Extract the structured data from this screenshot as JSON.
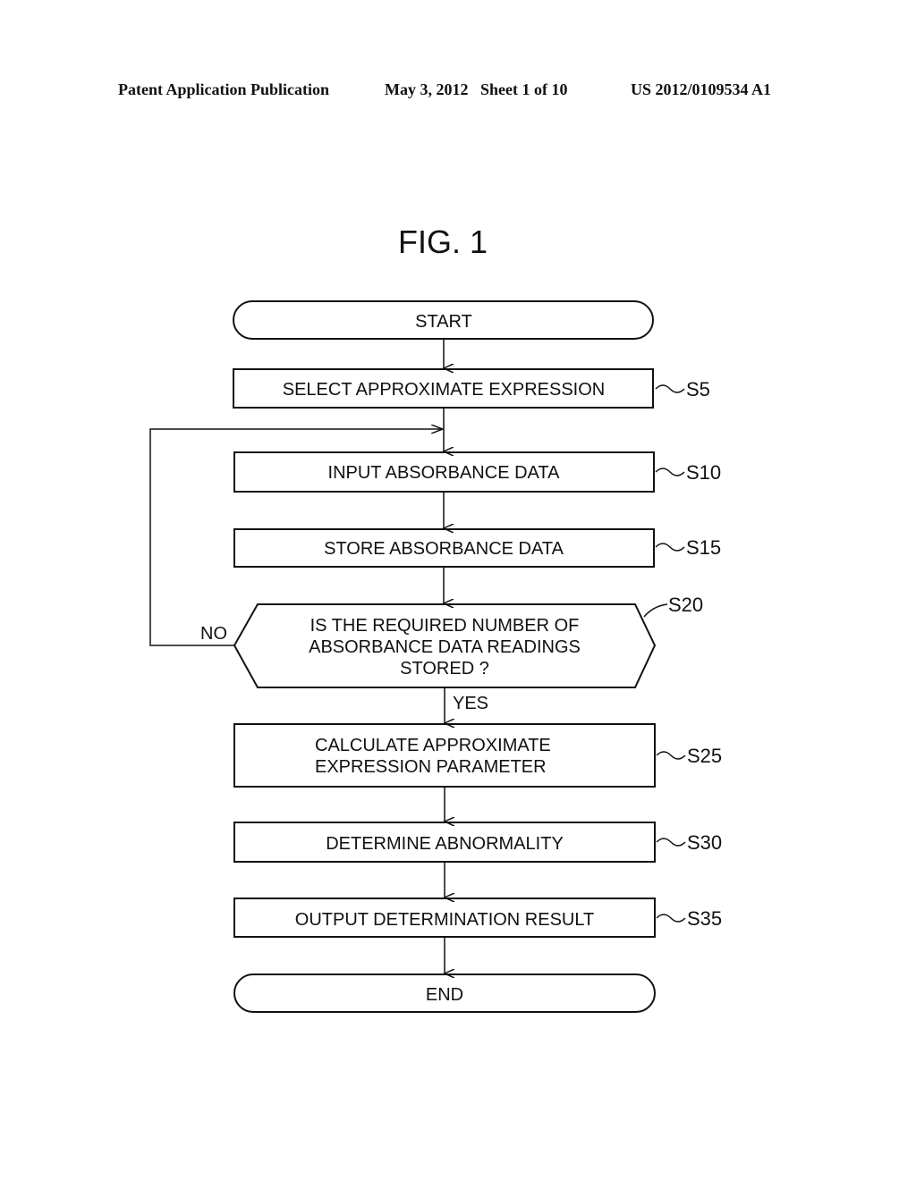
{
  "header": {
    "publication": "Patent Application Publication",
    "date_sheet": "May 3, 2012   Sheet 1 of 10",
    "number": "US 2012/0109534 A1"
  },
  "figure": {
    "title": "FIG. 1"
  },
  "flowchart": {
    "start": "START",
    "end": "END",
    "steps": [
      {
        "id": "S5",
        "lines": [
          "SELECT APPROXIMATE EXPRESSION"
        ]
      },
      {
        "id": "S10",
        "lines": [
          "INPUT ABSORBANCE DATA"
        ]
      },
      {
        "id": "S15",
        "lines": [
          "STORE ABSORBANCE DATA"
        ]
      },
      {
        "id": "S20",
        "lines": [
          "IS THE REQUIRED NUMBER OF",
          "ABSORBANCE DATA READINGS",
          "STORED ?"
        ]
      },
      {
        "id": "S25",
        "lines": [
          "CALCULATE APPROXIMATE",
          "EXPRESSION PARAMETER"
        ]
      },
      {
        "id": "S30",
        "lines": [
          "DETERMINE ABNORMALITY"
        ]
      },
      {
        "id": "S35",
        "lines": [
          "OUTPUT DETERMINATION RESULT"
        ]
      }
    ],
    "branch_no": "NO",
    "branch_yes": "YES"
  }
}
